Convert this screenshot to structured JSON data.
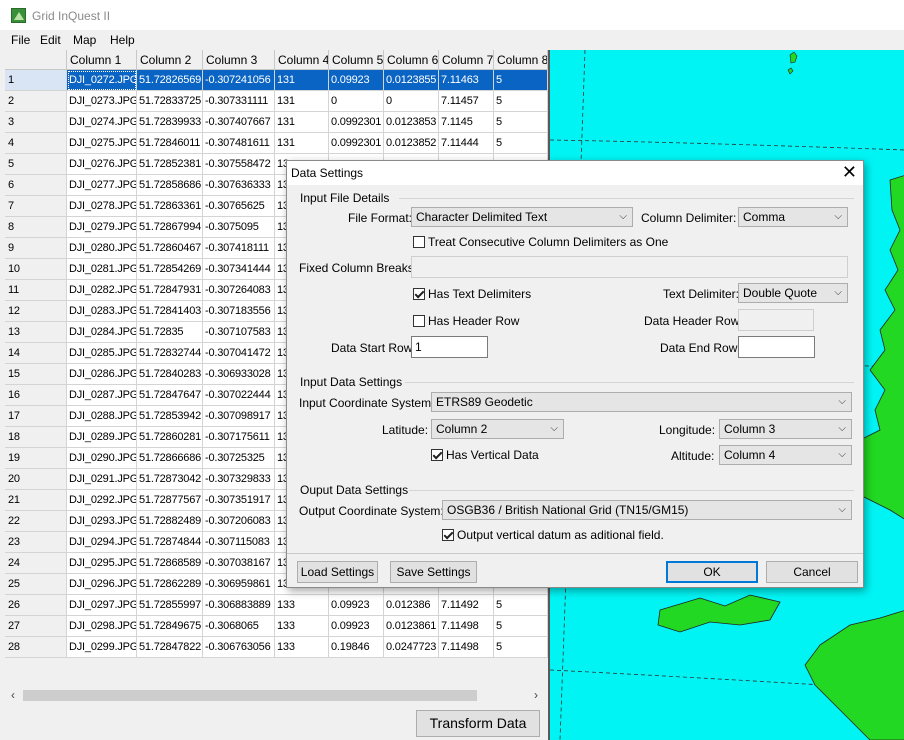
{
  "window": {
    "title": "Grid InQuest II"
  },
  "menu": [
    "File",
    "Edit",
    "Map",
    "Help"
  ],
  "table": {
    "columns": [
      "Column 1",
      "Column 2",
      "Column 3",
      "Column 4",
      "Column 5",
      "Column 6",
      "Column 7",
      "Column 8"
    ],
    "rows": [
      [
        "1",
        "DJI_0272.JPG",
        "51.72826569",
        "-0.307241056",
        "131",
        "0.09923",
        "0.0123855",
        "7.11463",
        "5"
      ],
      [
        "2",
        "DJI_0273.JPG",
        "51.72833725",
        "-0.307331111",
        "131",
        "0",
        "0",
        "7.11457",
        "5"
      ],
      [
        "3",
        "DJI_0274.JPG",
        "51.72839933",
        "-0.307407667",
        "131",
        "0.0992301",
        "0.0123853",
        "7.1145",
        "5"
      ],
      [
        "4",
        "DJI_0275.JPG",
        "51.72846011",
        "-0.307481611",
        "131",
        "0.0992301",
        "0.0123852",
        "7.11444",
        "5"
      ],
      [
        "5",
        "DJI_0276.JPG",
        "51.72852381",
        "-0.307558472",
        "13",
        "",
        "",
        "",
        ""
      ],
      [
        "6",
        "DJI_0277.JPG",
        "51.72858686",
        "-0.307636333",
        "13",
        "",
        "",
        "",
        ""
      ],
      [
        "7",
        "DJI_0278.JPG",
        "51.72863361",
        "-0.30765625",
        "13",
        "",
        "",
        "",
        ""
      ],
      [
        "8",
        "DJI_0279.JPG",
        "51.72867994",
        "-0.3075095",
        "13",
        "",
        "",
        "",
        ""
      ],
      [
        "9",
        "DJI_0280.JPG",
        "51.72860467",
        "-0.307418111",
        "13",
        "",
        "",
        "",
        ""
      ],
      [
        "10",
        "DJI_0281.JPG",
        "51.72854269",
        "-0.307341444",
        "13",
        "",
        "",
        "",
        ""
      ],
      [
        "11",
        "DJI_0282.JPG",
        "51.72847931",
        "-0.307264083",
        "13",
        "",
        "",
        "",
        ""
      ],
      [
        "12",
        "DJI_0283.JPG",
        "51.72841403",
        "-0.307183556",
        "13",
        "",
        "",
        "",
        ""
      ],
      [
        "13",
        "DJI_0284.JPG",
        "51.72835",
        "-0.307107583",
        "13",
        "",
        "",
        "",
        ""
      ],
      [
        "14",
        "DJI_0285.JPG",
        "51.72832744",
        "-0.307041472",
        "13",
        "",
        "",
        "",
        ""
      ],
      [
        "15",
        "DJI_0286.JPG",
        "51.72840283",
        "-0.306933028",
        "13",
        "",
        "",
        "",
        ""
      ],
      [
        "16",
        "DJI_0287.JPG",
        "51.72847647",
        "-0.307022444",
        "13",
        "",
        "",
        "",
        ""
      ],
      [
        "17",
        "DJI_0288.JPG",
        "51.72853942",
        "-0.307098917",
        "13",
        "",
        "",
        "",
        ""
      ],
      [
        "18",
        "DJI_0289.JPG",
        "51.72860281",
        "-0.307175611",
        "13",
        "",
        "",
        "",
        ""
      ],
      [
        "19",
        "DJI_0290.JPG",
        "51.72866686",
        "-0.30725325",
        "13",
        "",
        "",
        "",
        ""
      ],
      [
        "20",
        "DJI_0291.JPG",
        "51.72873042",
        "-0.307329833",
        "13",
        "",
        "",
        "",
        ""
      ],
      [
        "21",
        "DJI_0292.JPG",
        "51.72877567",
        "-0.307351917",
        "13",
        "",
        "",
        "",
        ""
      ],
      [
        "22",
        "DJI_0293.JPG",
        "51.72882489",
        "-0.307206083",
        "13",
        "",
        "",
        "",
        ""
      ],
      [
        "23",
        "DJI_0294.JPG",
        "51.72874844",
        "-0.307115083",
        "13",
        "",
        "",
        "",
        ""
      ],
      [
        "24",
        "DJI_0295.JPG",
        "51.72868589",
        "-0.307038167",
        "13",
        "",
        "",
        "",
        ""
      ],
      [
        "25",
        "DJI_0296.JPG",
        "51.72862289",
        "-0.306959861",
        "13",
        "",
        "",
        "",
        ""
      ],
      [
        "26",
        "DJI_0297.JPG",
        "51.72855997",
        "-0.306883889",
        "133",
        "0.09923",
        "0.012386",
        "7.11492",
        "5"
      ],
      [
        "27",
        "DJI_0298.JPG",
        "51.72849675",
        "-0.3068065",
        "133",
        "0.09923",
        "0.0123861",
        "7.11498",
        "5"
      ],
      [
        "28",
        "DJI_0299.JPG",
        "51.72847822",
        "-0.306763056",
        "133",
        "0.19846",
        "0.0247723",
        "7.11498",
        "5"
      ]
    ]
  },
  "transform_button": "Transform Data",
  "dialog": {
    "title": "Data Settings",
    "close": "✕",
    "input_file_details": {
      "heading": "Input File Details",
      "file_format_label": "File Format:",
      "file_format_value": "Character Delimited Text",
      "column_delimiter_label": "Column Delimiter:",
      "column_delimiter_value": "Comma",
      "treat_consecutive_label": "Treat Consecutive Column Delimiters as One",
      "treat_consecutive_checked": false,
      "fixed_breaks_label": "Fixed Column Breaks:",
      "has_text_delimiters_label": "Has Text Delimiters",
      "has_text_delimiters_checked": true,
      "text_delimiter_label": "Text Delimiter:",
      "text_delimiter_value": "Double Quote",
      "has_header_row_label": "Has Header Row",
      "has_header_row_checked": false,
      "data_header_row_label": "Data Header Row:",
      "data_start_row_label": "Data Start Row:",
      "data_start_row_value": "1",
      "data_end_row_label": "Data End Row:",
      "data_end_row_value": ""
    },
    "input_data_settings": {
      "heading": "Input Data Settings",
      "coord_system_label": "Input Coordinate System:",
      "coord_system_value": "ETRS89 Geodetic",
      "latitude_label": "Latitude:",
      "latitude_value": "Column 2",
      "longitude_label": "Longitude:",
      "longitude_value": "Column 3",
      "has_vertical_label": "Has Vertical Data",
      "has_vertical_checked": true,
      "altitude_label": "Altitude:",
      "altitude_value": "Column 4"
    },
    "output_data_settings": {
      "heading": "Ouput Data Settings",
      "coord_system_label": "Output Coordinate System:",
      "coord_system_value": "OSGB36 / British National Grid (TN15/GM15)",
      "vertical_datum_label": "Output vertical datum as aditional field.",
      "vertical_datum_checked": true
    },
    "buttons": {
      "load": "Load Settings",
      "save": "Save Settings",
      "ok": "OK",
      "cancel": "Cancel"
    }
  },
  "map": {
    "sea_color": "#00f4f4",
    "land_color": "#22d822"
  }
}
